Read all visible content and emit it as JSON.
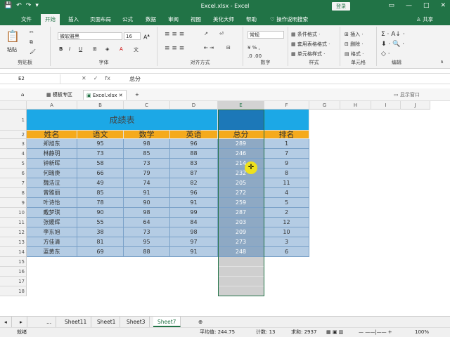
{
  "window": {
    "title": "Excel.xlsx - Excel",
    "login": "登录",
    "controls": [
      "▭",
      "—",
      "□",
      "✕"
    ]
  },
  "quick_access": [
    "💾",
    "↶",
    "↷",
    "▾"
  ],
  "ribbon_tabs": [
    "文件",
    "开始",
    "插入",
    "页面布局",
    "公式",
    "数据",
    "审阅",
    "视图",
    "美化大师",
    "帮助",
    "♡ 操作说明搜索"
  ],
  "share": "♙ 共享",
  "ribbon": {
    "paste": "粘贴",
    "clipboard": "剪贴板",
    "font_name": "微软雅黑",
    "font_size": "16",
    "font": "字体",
    "alignment": "对齐方式",
    "number_format": "常规",
    "number": "数字",
    "conditional": "条件格式 ·",
    "table_format": "套用表格格式 ·",
    "cell_style": "单元格样式 ·",
    "styles": "样式",
    "insert": "插入 ·",
    "delete": "删除 ·",
    "format": "格式 ·",
    "cells": "单元格",
    "editing": "编辑"
  },
  "formula_bar": {
    "name_box": "E2",
    "formula": "总分"
  },
  "doc_tabs": [
    "模板专区",
    "Excel.xlsx",
    "+"
  ],
  "show_window": "显示窗口",
  "columns": [
    "A",
    "B",
    "C",
    "D",
    "E",
    "F",
    "G",
    "H",
    "I",
    "J"
  ],
  "rows": [
    "1",
    "2",
    "3",
    "4",
    "5",
    "6",
    "7",
    "8",
    "9",
    "10",
    "11",
    "12",
    "13",
    "14",
    "15",
    "16",
    "17",
    "18"
  ],
  "table": {
    "title": "成绩表",
    "headers": [
      "姓名",
      "语文",
      "数学",
      "英语",
      "总分",
      "排名"
    ],
    "rows": [
      [
        "郑旭东",
        "95",
        "98",
        "96",
        "289",
        "1"
      ],
      [
        "林静玥",
        "73",
        "85",
        "88",
        "246",
        "7"
      ],
      [
        "钟新晖",
        "58",
        "73",
        "83",
        "214",
        "9"
      ],
      [
        "何瑞庚",
        "66",
        "79",
        "87",
        "232",
        "8"
      ],
      [
        "魏浩泣",
        "49",
        "74",
        "82",
        "205",
        "11"
      ],
      [
        "曾雅丽",
        "85",
        "91",
        "96",
        "272",
        "4"
      ],
      [
        "叶诗怡",
        "78",
        "90",
        "91",
        "259",
        "5"
      ],
      [
        "戴梦琪",
        "90",
        "98",
        "99",
        "287",
        "2"
      ],
      [
        "张媛辉",
        "55",
        "64",
        "84",
        "203",
        "12"
      ],
      [
        "李东旭",
        "38",
        "73",
        "98",
        "209",
        "10"
      ],
      [
        "方佳清",
        "81",
        "95",
        "97",
        "273",
        "3"
      ],
      [
        "蓝黄东",
        "69",
        "88",
        "91",
        "248",
        "6"
      ]
    ]
  },
  "sheets": [
    "◂",
    "▸",
    "...",
    "Sheet11",
    "Sheet1",
    "Sheet3",
    "Sheet7",
    "⊕"
  ],
  "status": {
    "ready": "就绪",
    "average": "平均值: 244.75",
    "count": "计数: 13",
    "sum": "求和: 2937",
    "zoom": "100%"
  }
}
